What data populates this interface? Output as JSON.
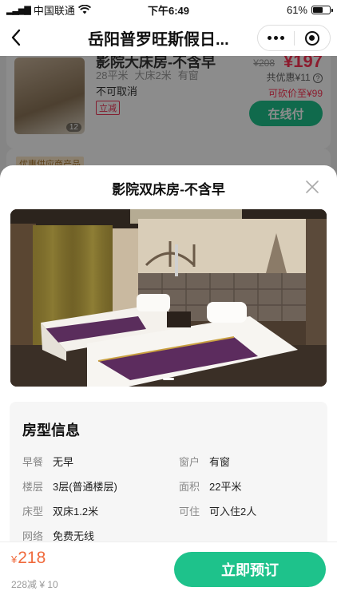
{
  "status_bar": {
    "carrier": "中国联通",
    "time": "下午6:49",
    "battery": "61%",
    "battery_level": 0.61
  },
  "nav": {
    "title": "岳阳普罗旺斯假日..."
  },
  "background_card": {
    "room_name": "影院大床房-不含早",
    "specs": [
      "28平米",
      "大床2米",
      "有窗"
    ],
    "cancel_policy": "不可取消",
    "tag": "立减",
    "photo_count": "12",
    "original_price": "¥208",
    "price": "¥197",
    "discount": "共优惠¥11",
    "bargain": "可砍价至¥99",
    "pay_button": "在线付",
    "promo_tag": "优惠供应商产品"
  },
  "sheet": {
    "title": "影院双床房-不含早",
    "info_title": "房型信息",
    "rows": [
      {
        "label": "早餐",
        "value": "无早",
        "label2": "窗户",
        "value2": "有窗"
      },
      {
        "label": "楼层",
        "value": "3层(普通楼层)",
        "label2": "面积",
        "value2": "22平米"
      },
      {
        "label": "床型",
        "value": "双床1.2米",
        "label2": "可住",
        "value2": "可入住2人"
      },
      {
        "label": "网络",
        "value": "免费无线"
      }
    ]
  },
  "bottom_bar": {
    "currency": "¥",
    "price": "218",
    "sub": "228减 ¥ 10",
    "book_button": "立即预订"
  },
  "colors": {
    "accent_green": "#1ec28b",
    "price_orange": "#f06a3c",
    "price_red": "#f35"
  }
}
